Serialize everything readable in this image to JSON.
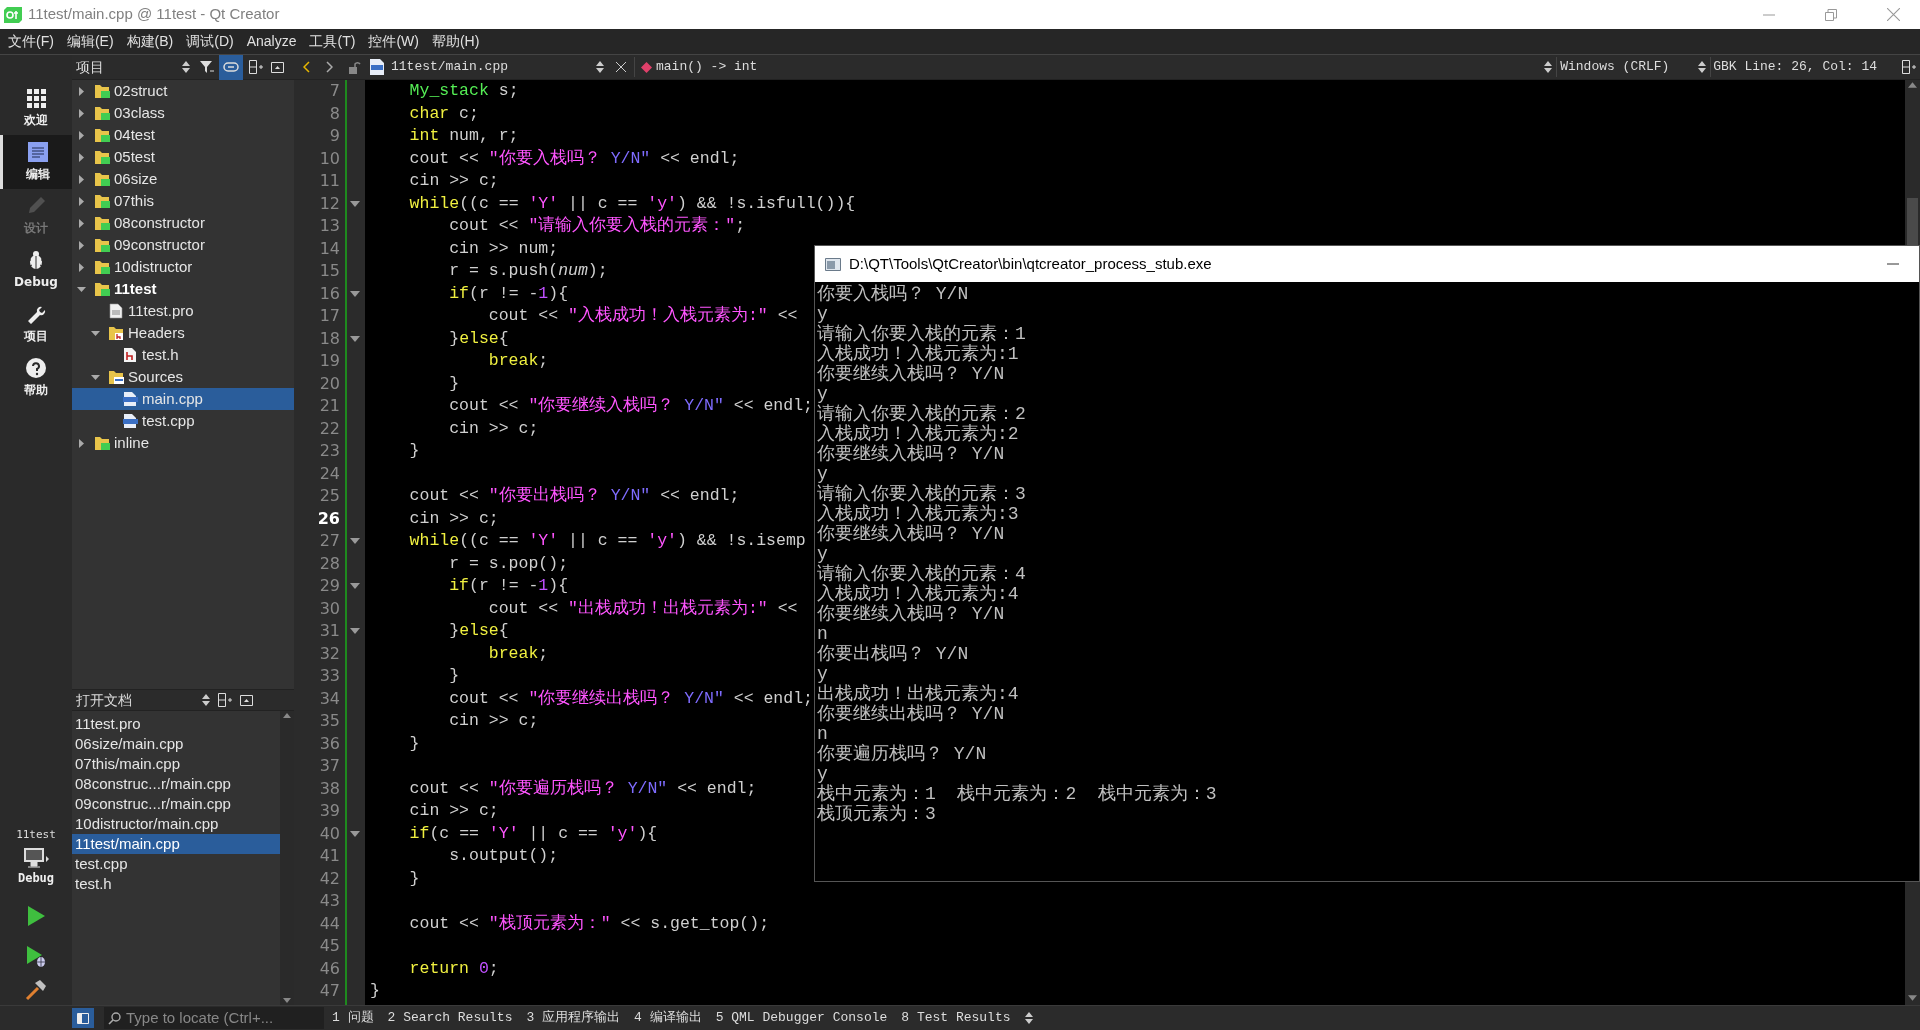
{
  "window": {
    "title": "11test/main.cpp @ 11test - Qt Creator"
  },
  "menu": [
    "文件(F)",
    "编辑(E)",
    "构建(B)",
    "调试(D)",
    "Analyze",
    "工具(T)",
    "控件(W)",
    "帮助(H)"
  ],
  "modes": [
    {
      "label": "欢迎",
      "kind": "welcome",
      "selected": false,
      "disabled": false
    },
    {
      "label": "编辑",
      "kind": "edit",
      "selected": true,
      "disabled": false
    },
    {
      "label": "设计",
      "kind": "design",
      "selected": false,
      "disabled": true
    },
    {
      "label": "Debug",
      "kind": "debug",
      "selected": false,
      "disabled": false
    },
    {
      "label": "项目",
      "kind": "projects",
      "selected": false,
      "disabled": false
    },
    {
      "label": "帮助",
      "kind": "help",
      "selected": false,
      "disabled": false
    }
  ],
  "run_panel": {
    "project": "11test",
    "config": "Debug"
  },
  "project_pane": {
    "title": "项目",
    "sync_toggle": {
      "on": true
    },
    "tree": [
      {
        "label": "02struct",
        "kind": "project",
        "expanded": false,
        "selected": false,
        "active": false
      },
      {
        "label": "03class",
        "kind": "project",
        "expanded": false,
        "selected": false,
        "active": false
      },
      {
        "label": "04test",
        "kind": "project",
        "expanded": false,
        "selected": false,
        "active": false
      },
      {
        "label": "05test",
        "kind": "project",
        "expanded": false,
        "selected": false,
        "active": false
      },
      {
        "label": "06size",
        "kind": "project",
        "expanded": false,
        "selected": false,
        "active": false
      },
      {
        "label": "07this",
        "kind": "project",
        "expanded": false,
        "selected": false,
        "active": false
      },
      {
        "label": "08constructor",
        "kind": "project",
        "expanded": false,
        "selected": false,
        "active": false
      },
      {
        "label": "09constructor",
        "kind": "project",
        "expanded": false,
        "selected": false,
        "active": false
      },
      {
        "label": "10distructor",
        "kind": "project",
        "expanded": false,
        "selected": false,
        "active": false
      },
      {
        "label": "11test",
        "kind": "project",
        "expanded": true,
        "selected": false,
        "active": true,
        "children": [
          {
            "label": "11test.pro",
            "kind": "pro_file",
            "selected": false,
            "active": false
          },
          {
            "label": "Headers",
            "kind": "header_folder",
            "expanded": true,
            "selected": false,
            "active": false,
            "children": [
              {
                "label": "test.h",
                "kind": "header_file",
                "selected": false,
                "active": false
              }
            ]
          },
          {
            "label": "Sources",
            "kind": "source_folder",
            "expanded": true,
            "selected": false,
            "active": false,
            "children": [
              {
                "label": "main.cpp",
                "kind": "source_file",
                "selected": true,
                "active": false
              },
              {
                "label": "test.cpp",
                "kind": "source_file",
                "selected": false,
                "active": false
              }
            ]
          }
        ]
      },
      {
        "label": "inline",
        "kind": "project",
        "expanded": false,
        "selected": false,
        "active": false
      }
    ]
  },
  "open_documents": {
    "title": "打开文档",
    "items": [
      {
        "label": "11test.pro",
        "selected": false
      },
      {
        "label": "06size/main.cpp",
        "selected": false
      },
      {
        "label": "07this/main.cpp",
        "selected": false
      },
      {
        "label": "08construc...r/main.cpp",
        "selected": false
      },
      {
        "label": "09construc...r/main.cpp",
        "selected": false
      },
      {
        "label": "10distructor/main.cpp",
        "selected": false
      },
      {
        "label": "11test/main.cpp",
        "selected": true
      },
      {
        "label": "test.cpp",
        "selected": false
      },
      {
        "label": "test.h",
        "selected": false
      }
    ]
  },
  "editor": {
    "file": "11test/main.cpp",
    "symbol": "main() -> int",
    "line_ending": "Windows (CRLF)",
    "position": "GBK Line: 26, Col: 14",
    "lines": [
      {
        "number": "7",
        "current": false,
        "foldable": false,
        "tokens": [
          {
            "kind": "type",
            "text": "    My_stack"
          },
          {
            "kind": "plain",
            "text": " s;"
          }
        ]
      },
      {
        "number": "8",
        "current": false,
        "foldable": false,
        "tokens": [
          {
            "kind": "keyword",
            "text": "    char"
          },
          {
            "kind": "plain",
            "text": " c;"
          }
        ]
      },
      {
        "number": "9",
        "current": false,
        "foldable": false,
        "tokens": [
          {
            "kind": "keyword",
            "text": "    int"
          },
          {
            "kind": "plain",
            "text": " num, r;"
          }
        ]
      },
      {
        "number": "10",
        "current": false,
        "foldable": false,
        "tokens": [
          {
            "kind": "plain",
            "text": "    cout << "
          },
          {
            "kind": "string",
            "text": "\"你要入栈吗？ "
          },
          {
            "kind": "latin",
            "text": "Y/N\""
          },
          {
            "kind": "plain",
            "text": " << endl;"
          }
        ]
      },
      {
        "number": "11",
        "current": false,
        "foldable": false,
        "tokens": [
          {
            "kind": "plain",
            "text": "    cin >> c;"
          }
        ]
      },
      {
        "number": "12",
        "current": false,
        "foldable": true,
        "tokens": [
          {
            "kind": "keyword",
            "text": "    while"
          },
          {
            "kind": "plain",
            "text": "((c == "
          },
          {
            "kind": "string",
            "text": "'Y'"
          },
          {
            "kind": "plain",
            "text": " || c == "
          },
          {
            "kind": "string",
            "text": "'y'"
          },
          {
            "kind": "plain",
            "text": ") && !s.isfull()){"
          }
        ]
      },
      {
        "number": "13",
        "current": false,
        "foldable": false,
        "tokens": [
          {
            "kind": "plain",
            "text": "        cout << "
          },
          {
            "kind": "string",
            "text": "\"请输入你要入栈的元素：\""
          },
          {
            "kind": "plain",
            "text": ";"
          }
        ]
      },
      {
        "number": "14",
        "current": false,
        "foldable": false,
        "tokens": [
          {
            "kind": "plain",
            "text": "        cin >> num;"
          }
        ]
      },
      {
        "number": "15",
        "current": false,
        "foldable": false,
        "tokens": [
          {
            "kind": "plain",
            "text": "        r = s.push("
          },
          {
            "kind": "param",
            "text": "num"
          },
          {
            "kind": "plain",
            "text": ");"
          }
        ]
      },
      {
        "number": "16",
        "current": false,
        "foldable": true,
        "tokens": [
          {
            "kind": "keyword",
            "text": "        if"
          },
          {
            "kind": "plain",
            "text": "(r != -"
          },
          {
            "kind": "number",
            "text": "1"
          },
          {
            "kind": "plain",
            "text": "){"
          }
        ]
      },
      {
        "number": "17",
        "current": false,
        "foldable": false,
        "tokens": [
          {
            "kind": "plain",
            "text": "            cout << "
          },
          {
            "kind": "string",
            "text": "\"入栈成功！入栈元素为:\""
          },
          {
            "kind": "plain",
            "text": " <<"
          }
        ]
      },
      {
        "number": "18",
        "current": false,
        "foldable": true,
        "tokens": [
          {
            "kind": "plain",
            "text": "        }"
          },
          {
            "kind": "keyword",
            "text": "else"
          },
          {
            "kind": "plain",
            "text": "{"
          }
        ]
      },
      {
        "number": "19",
        "current": false,
        "foldable": false,
        "tokens": [
          {
            "kind": "keyword",
            "text": "            break"
          },
          {
            "kind": "plain",
            "text": ";"
          }
        ]
      },
      {
        "number": "20",
        "current": false,
        "foldable": false,
        "tokens": [
          {
            "kind": "plain",
            "text": "        }"
          }
        ]
      },
      {
        "number": "21",
        "current": false,
        "foldable": false,
        "tokens": [
          {
            "kind": "plain",
            "text": "        cout << "
          },
          {
            "kind": "string",
            "text": "\"你要继续入栈吗？ "
          },
          {
            "kind": "latin",
            "text": "Y/N\""
          },
          {
            "kind": "plain",
            "text": " << endl;"
          }
        ]
      },
      {
        "number": "22",
        "current": false,
        "foldable": false,
        "tokens": [
          {
            "kind": "plain",
            "text": "        cin >> c;"
          }
        ]
      },
      {
        "number": "23",
        "current": false,
        "foldable": false,
        "tokens": [
          {
            "kind": "plain",
            "text": "    }"
          }
        ]
      },
      {
        "number": "24",
        "current": false,
        "foldable": false
      },
      {
        "number": "25",
        "current": false,
        "foldable": false,
        "tokens": [
          {
            "kind": "plain",
            "text": "    cout << "
          },
          {
            "kind": "string",
            "text": "\"你要出栈吗？ "
          },
          {
            "kind": "latin",
            "text": "Y/N\""
          },
          {
            "kind": "plain",
            "text": " << endl;"
          }
        ]
      },
      {
        "number": "26",
        "current": true,
        "foldable": false,
        "tokens": [
          {
            "kind": "plain",
            "text": "    cin >> c;"
          }
        ]
      },
      {
        "number": "27",
        "current": false,
        "foldable": true,
        "tokens": [
          {
            "kind": "keyword",
            "text": "    while"
          },
          {
            "kind": "plain",
            "text": "((c == "
          },
          {
            "kind": "string",
            "text": "'Y'"
          },
          {
            "kind": "plain",
            "text": " || c == "
          },
          {
            "kind": "string",
            "text": "'y'"
          },
          {
            "kind": "plain",
            "text": ") && !s.isemp"
          }
        ]
      },
      {
        "number": "28",
        "current": false,
        "foldable": false,
        "tokens": [
          {
            "kind": "plain",
            "text": "        r = s.pop();"
          }
        ]
      },
      {
        "number": "29",
        "current": false,
        "foldable": true,
        "tokens": [
          {
            "kind": "keyword",
            "text": "        if"
          },
          {
            "kind": "plain",
            "text": "(r != -"
          },
          {
            "kind": "number",
            "text": "1"
          },
          {
            "kind": "plain",
            "text": "){"
          }
        ]
      },
      {
        "number": "30",
        "current": false,
        "foldable": false,
        "tokens": [
          {
            "kind": "plain",
            "text": "            cout << "
          },
          {
            "kind": "string",
            "text": "\"出栈成功！出栈元素为:\""
          },
          {
            "kind": "plain",
            "text": " <<"
          }
        ]
      },
      {
        "number": "31",
        "current": false,
        "foldable": true,
        "tokens": [
          {
            "kind": "plain",
            "text": "        }"
          },
          {
            "kind": "keyword",
            "text": "else"
          },
          {
            "kind": "plain",
            "text": "{"
          }
        ]
      },
      {
        "number": "32",
        "current": false,
        "foldable": false,
        "tokens": [
          {
            "kind": "keyword",
            "text": "            break"
          },
          {
            "kind": "plain",
            "text": ";"
          }
        ]
      },
      {
        "number": "33",
        "current": false,
        "foldable": false,
        "tokens": [
          {
            "kind": "plain",
            "text": "        }"
          }
        ]
      },
      {
        "number": "34",
        "current": false,
        "foldable": false,
        "tokens": [
          {
            "kind": "plain",
            "text": "        cout << "
          },
          {
            "kind": "string",
            "text": "\"你要继续出栈吗？ "
          },
          {
            "kind": "latin",
            "text": "Y/N\""
          },
          {
            "kind": "plain",
            "text": " << endl;"
          }
        ]
      },
      {
        "number": "35",
        "current": false,
        "foldable": false,
        "tokens": [
          {
            "kind": "plain",
            "text": "        cin >> c;"
          }
        ]
      },
      {
        "number": "36",
        "current": false,
        "foldable": false,
        "tokens": [
          {
            "kind": "plain",
            "text": "    }"
          }
        ]
      },
      {
        "number": "37",
        "current": false,
        "foldable": false
      },
      {
        "number": "38",
        "current": false,
        "foldable": false,
        "tokens": [
          {
            "kind": "plain",
            "text": "    cout << "
          },
          {
            "kind": "string",
            "text": "\"你要遍历栈吗？ "
          },
          {
            "kind": "latin",
            "text": "Y/N\""
          },
          {
            "kind": "plain",
            "text": " << endl;"
          }
        ]
      },
      {
        "number": "39",
        "current": false,
        "foldable": false,
        "tokens": [
          {
            "kind": "plain",
            "text": "    cin >> c;"
          }
        ]
      },
      {
        "number": "40",
        "current": false,
        "foldable": true,
        "tokens": [
          {
            "kind": "keyword",
            "text": "    if"
          },
          {
            "kind": "plain",
            "text": "(c == "
          },
          {
            "kind": "string",
            "text": "'Y'"
          },
          {
            "kind": "plain",
            "text": " || c == "
          },
          {
            "kind": "string",
            "text": "'y'"
          },
          {
            "kind": "plain",
            "text": "){"
          }
        ]
      },
      {
        "number": "41",
        "current": false,
        "foldable": false,
        "tokens": [
          {
            "kind": "plain",
            "text": "        s.output();"
          }
        ]
      },
      {
        "number": "42",
        "current": false,
        "foldable": false,
        "tokens": [
          {
            "kind": "plain",
            "text": "    }"
          }
        ]
      },
      {
        "number": "43",
        "current": false,
        "foldable": false
      },
      {
        "number": "44",
        "current": false,
        "foldable": false,
        "tokens": [
          {
            "kind": "plain",
            "text": "    cout << "
          },
          {
            "kind": "string",
            "text": "\"栈顶元素为：\""
          },
          {
            "kind": "plain",
            "text": " << s.get_top();"
          }
        ]
      },
      {
        "number": "45",
        "current": false,
        "foldable": false
      },
      {
        "number": "46",
        "current": false,
        "foldable": false,
        "tokens": [
          {
            "kind": "keyword",
            "text": "    return"
          },
          {
            "kind": "number",
            "text": " 0"
          },
          {
            "kind": "plain",
            "text": ";"
          }
        ]
      },
      {
        "number": "47",
        "current": false,
        "foldable": false,
        "tokens": [
          {
            "kind": "plain",
            "text": "}"
          }
        ]
      }
    ]
  },
  "console": {
    "title": "D:\\QT\\Tools\\QtCreator\\bin\\qtcreator_process_stub.exe",
    "lines": [
      "你要入栈吗？ Y/N",
      "y",
      "请输入你要入栈的元素：1",
      "入栈成功！入栈元素为:1",
      "你要继续入栈吗？ Y/N",
      "y",
      "请输入你要入栈的元素：2",
      "入栈成功！入栈元素为:2",
      "你要继续入栈吗？ Y/N",
      "y",
      "请输入你要入栈的元素：3",
      "入栈成功！入栈元素为:3",
      "你要继续入栈吗？ Y/N",
      "y",
      "请输入你要入栈的元素：4",
      "入栈成功！入栈元素为:4",
      "你要继续入栈吗？ Y/N",
      "n",
      "你要出栈吗？ Y/N",
      "y",
      "出栈成功！出栈元素为:4",
      "你要继续出栈吗？ Y/N",
      "n",
      "你要遍历栈吗？ Y/N",
      "y",
      "栈中元素为：1  栈中元素为：2  栈中元素为：3",
      "栈顶元素为：3"
    ]
  },
  "status_bar": {
    "locate_placeholder": "Type to locate (Ctrl+...",
    "panes": [
      "1 问题",
      "2 Search Results",
      "3 应用程序输出",
      "4 编译输出",
      "5 QML Debugger Console",
      "8 Test Results"
    ]
  }
}
